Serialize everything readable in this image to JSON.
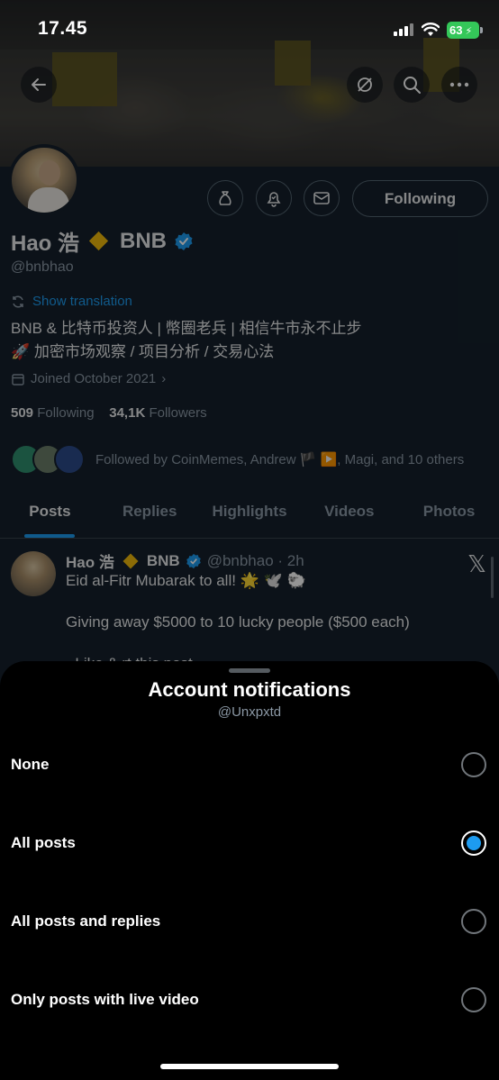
{
  "status_bar": {
    "time": "17.45",
    "battery": "63"
  },
  "profile": {
    "name": "Hao 浩",
    "name_suffix": "BNB",
    "handle": "@bnbhao",
    "following_button": "Following",
    "show_translation": "Show translation",
    "bio_line1": "BNB & 比特币投资人 | 幣圈老兵 | 相信牛市永不止步",
    "bio_line2": "🚀 加密市场观察 / 项目分析 / 交易心法",
    "joined": "Joined October 2021",
    "following_count": "509",
    "following_label": "Following",
    "followers_count": "34,1K",
    "followers_label": "Followers",
    "followed_by": "Followed by CoinMemes, Andrew 🏴 ▶️, Magi, and 10 others"
  },
  "tabs": [
    "Posts",
    "Replies",
    "Highlights",
    "Videos",
    "Photos"
  ],
  "post": {
    "author": "Hao 浩",
    "author_suffix": "BNB",
    "handle_time": "@bnbhao · 2h",
    "line1": "Eid al-Fitr Mubarak to all! 🌟 🕊️ 🐑",
    "line2": "Giving away $5000 to 10 lucky people ($500 each)",
    "line3": "- Like & rt this post"
  },
  "sheet": {
    "title": "Account notifications",
    "subtitle": "@Unxpxtd",
    "options": [
      {
        "label": "None",
        "selected": false
      },
      {
        "label": "All posts",
        "selected": true
      },
      {
        "label": "All posts and replies",
        "selected": false
      },
      {
        "label": "Only posts with live video",
        "selected": false
      }
    ]
  },
  "colors": {
    "accent": "#1d9bf0",
    "verified": "#1d9bf0",
    "bnb": "#f0b90b",
    "battery": "#34c759"
  }
}
